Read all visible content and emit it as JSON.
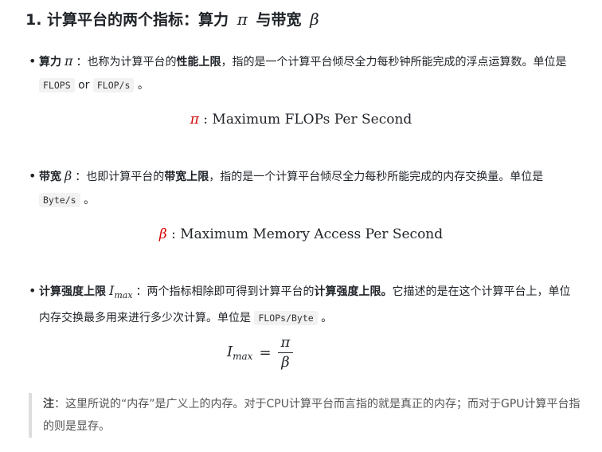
{
  "heading": {
    "prefix": "1. 计算平台的两个指标：算力",
    "pi": "π",
    "middle": "与带宽",
    "beta": "β"
  },
  "item1": {
    "label": "算力",
    "symbol": "π",
    "t1": "：也称为计算平台的",
    "bold": "性能上限",
    "t2": "，指的是一个计算平台倾尽全力每秒钟所能完成的浮点运算数。单位是",
    "code1": "FLOPS",
    "or": "or",
    "code2": "FLOP/s",
    "end": "。"
  },
  "eq1": {
    "symbol": "π",
    "text": " : Maximum FLOPs Per Second"
  },
  "item2": {
    "label": "带宽",
    "symbol": "β",
    "t1": "：也即计算平台的",
    "bold": "带宽上限",
    "t2": "，指的是一个计算平台倾尽全力每秒所能完成的内存交换量。单位是",
    "code1": "Byte/s",
    "end": "。"
  },
  "eq2": {
    "symbol": "β",
    "text": " : Maximum Memory Access Per Second"
  },
  "item3": {
    "label": "计算强度上限",
    "symbol": "I",
    "symbol_sub": "max",
    "t1": "：两个指标相除即可得到计算平台的",
    "bold": "计算强度上限。",
    "t2": "它描述的是在这个计算平台上，单位内存交换最多用来进行多少次计算。单位是",
    "code1": "FLOPs/Byte",
    "end": "。"
  },
  "eq3": {
    "lhs": "I",
    "lhs_sub": "max",
    "equals": "=",
    "numerator": "π",
    "denominator": "β"
  },
  "note": {
    "label": "注",
    "text": "：这里所说的“内存”是广义上的内存。对于CPU计算平台而言指的就是真正的内存；而对于GPU计算平台指的则是显存。"
  }
}
